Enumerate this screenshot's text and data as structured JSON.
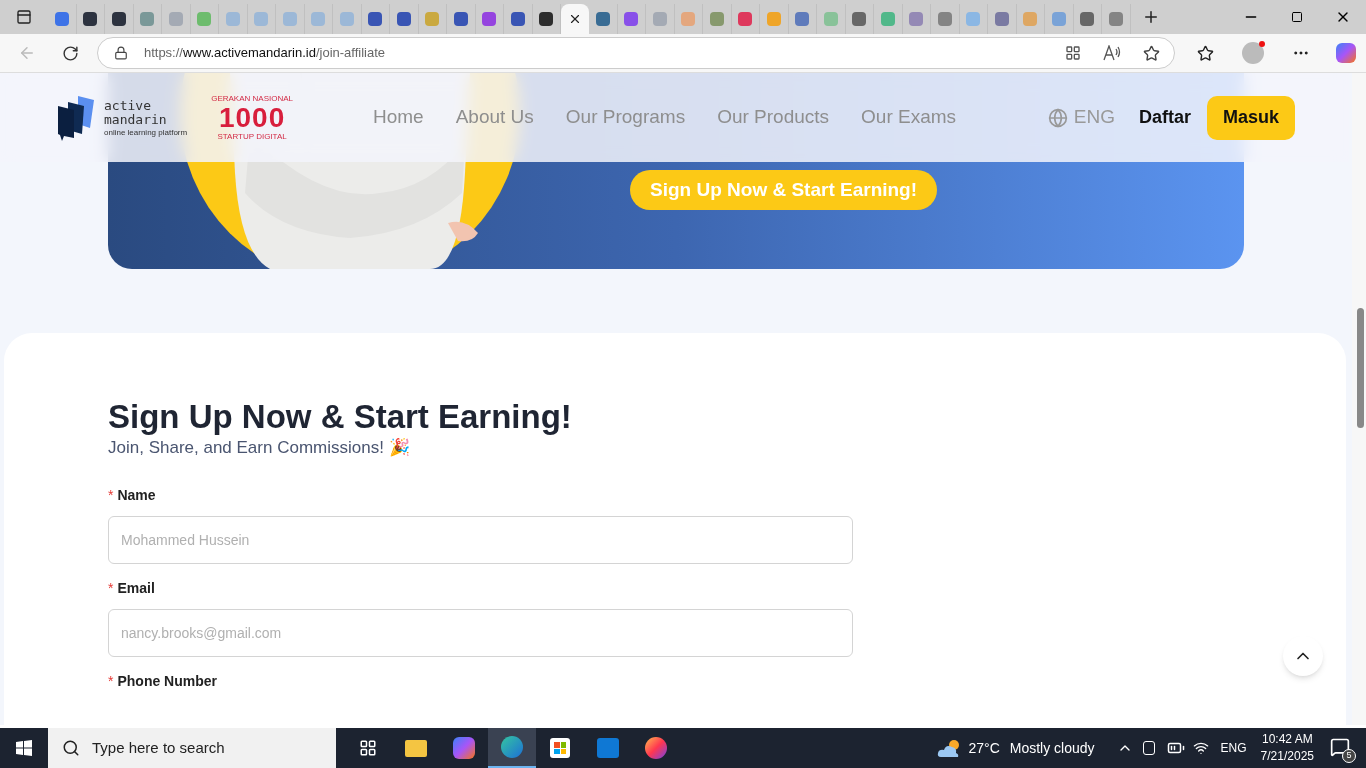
{
  "browser": {
    "tabs": [
      {
        "selected": false
      },
      {
        "selected": false
      },
      {
        "selected": false
      },
      {
        "selected": false
      },
      {
        "selected": false
      },
      {
        "selected": false
      },
      {
        "selected": false
      },
      {
        "selected": false
      },
      {
        "selected": false
      },
      {
        "selected": false
      },
      {
        "selected": false
      },
      {
        "selected": false
      },
      {
        "selected": false
      },
      {
        "selected": false
      },
      {
        "selected": false
      },
      {
        "selected": false
      },
      {
        "selected": false
      },
      {
        "selected": false
      },
      {
        "selected": true
      },
      {
        "selected": false
      },
      {
        "selected": false
      },
      {
        "selected": false
      },
      {
        "selected": false
      },
      {
        "selected": false
      },
      {
        "selected": false
      },
      {
        "selected": false
      },
      {
        "selected": false
      },
      {
        "selected": false
      },
      {
        "selected": false
      },
      {
        "selected": false
      },
      {
        "selected": false
      },
      {
        "selected": false
      },
      {
        "selected": false
      },
      {
        "selected": false
      },
      {
        "selected": false
      },
      {
        "selected": false
      },
      {
        "selected": false
      },
      {
        "selected": false
      }
    ],
    "url_prefix": "https://",
    "url_host": "www.activemandarin.id",
    "url_path": "/join-affiliate"
  },
  "header": {
    "logo": {
      "line1": "active",
      "line2": "mandarin",
      "tagline": "online learning platform"
    },
    "badge": {
      "top": "GERAKAN NASIONAL",
      "number": "1000",
      "bottom": "STARTUP DIGITAL"
    },
    "nav": [
      {
        "label": "Home"
      },
      {
        "label": "About Us"
      },
      {
        "label": "Our Programs"
      },
      {
        "label": "Our Products"
      },
      {
        "label": "Our Exams"
      }
    ],
    "language": "ENG",
    "register": "Daftar",
    "login": "Masuk"
  },
  "hero": {
    "button": "Sign Up Now & Start Earning!"
  },
  "form": {
    "title": "Sign Up Now & Start Earning!",
    "subtitle": "Join, Share, and Earn Commissions! 🎉",
    "fields": [
      {
        "marker": "*",
        "label": "Name",
        "placeholder": "Mohammed Hussein"
      },
      {
        "marker": "*",
        "label": "Email",
        "placeholder": "nancy.brooks@gmail.com"
      },
      {
        "marker": "*",
        "label": "Phone Number"
      }
    ]
  },
  "taskbar": {
    "search_placeholder": "Type here to search",
    "weather": {
      "temp": "27°C",
      "text": "Mostly cloudy"
    },
    "language": "ENG",
    "time": "10:42 AM",
    "date": "7/21/2025",
    "notifications": "5"
  }
}
